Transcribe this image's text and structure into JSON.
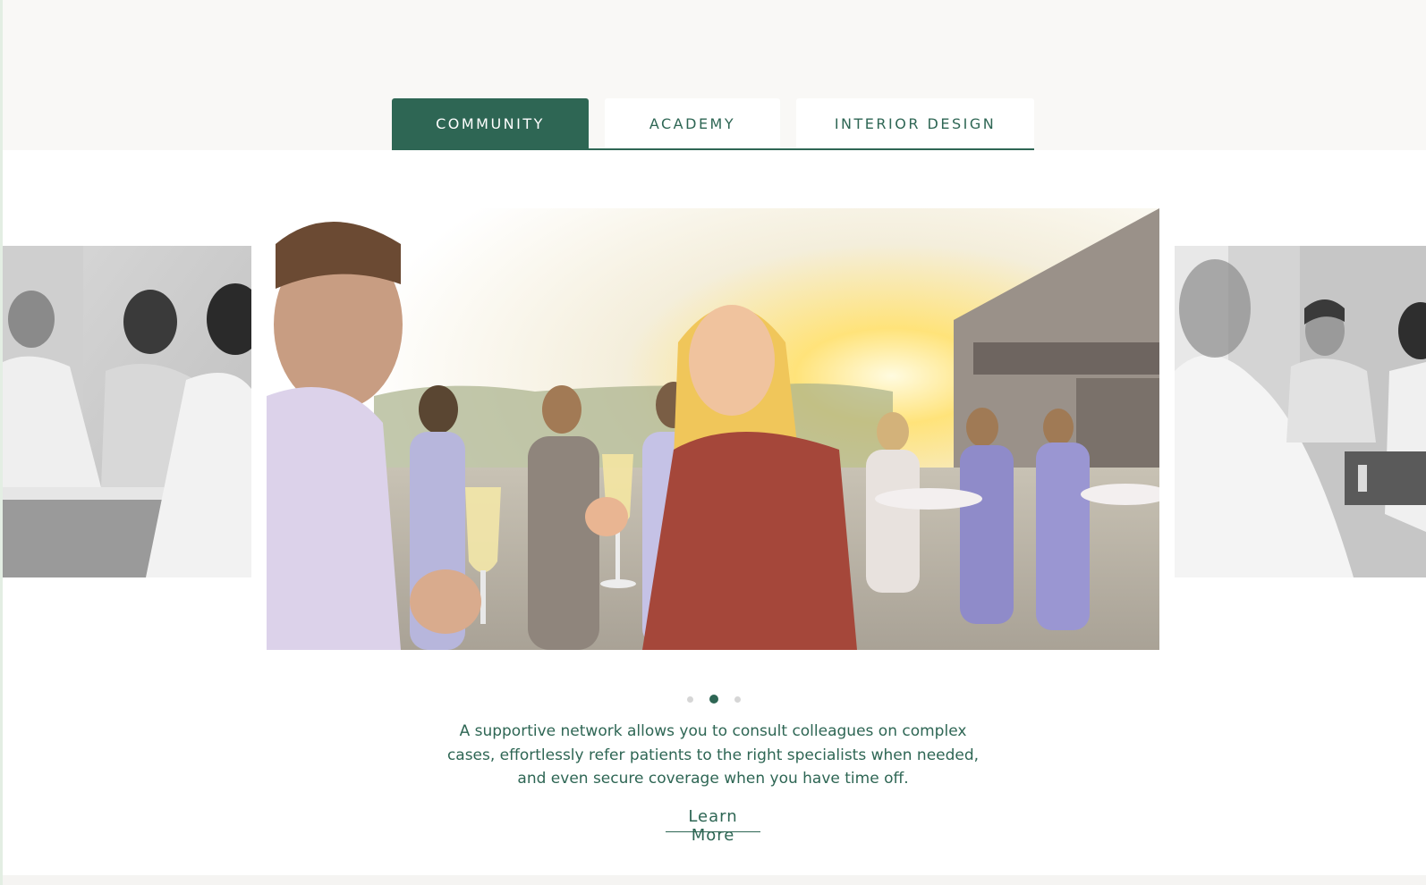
{
  "tabs": [
    {
      "label": "COMMUNITY",
      "active": true
    },
    {
      "label": "ACADEMY",
      "active": false
    },
    {
      "label": "INTERIOR DESIGN",
      "active": false
    }
  ],
  "carousel": {
    "slides": [
      {
        "icon": "meeting-photo-bw"
      },
      {
        "icon": "rooftop-networking-photo"
      },
      {
        "icon": "clinic-staff-photo-bw"
      }
    ],
    "current_slide": 2,
    "total_slides": 3
  },
  "description": "A supportive network allows you to consult colleagues on complex cases, effortlessly refer patients to the right specialists when needed, and even secure coverage when you have time off.",
  "cta": {
    "label": "Learn More"
  },
  "colors": {
    "accent": "#2e6654",
    "top_band": "#f9f8f6",
    "dot_inactive": "#d6d6d6"
  }
}
